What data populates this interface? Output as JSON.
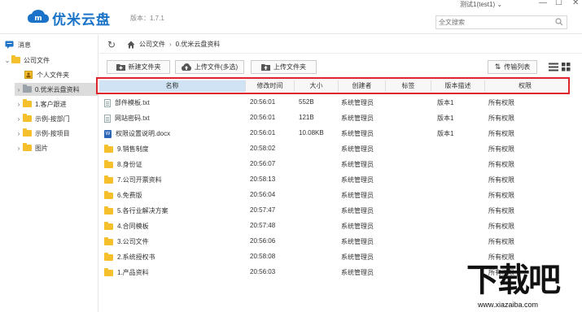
{
  "app": {
    "brand": "优米云盘",
    "version": "版本：1.7.1",
    "user": "测试1(test1)",
    "search_placeholder": "全文搜索"
  },
  "sidebar": {
    "items": [
      {
        "label": "消息"
      },
      {
        "label": "公司文件"
      },
      {
        "label": "个人文件夹"
      },
      {
        "label": "0.优米云盘资料"
      },
      {
        "label": "1.客户跟进"
      },
      {
        "label": "示例-按部门"
      },
      {
        "label": "示例-按项目"
      },
      {
        "label": "图片"
      }
    ]
  },
  "breadcrumb": {
    "items": [
      "公司文件",
      "0.优米云盘资料"
    ]
  },
  "toolbar": {
    "new_folder": "新建文件夹",
    "upload_file": "上传文件(多选)",
    "upload_folder": "上传文件夹",
    "transfer_list": "传输列表"
  },
  "table": {
    "columns": [
      "名称",
      "修改时间",
      "大小",
      "创建者",
      "标签",
      "版本描述",
      "权限"
    ],
    "rows": [
      {
        "name": "部件模板.txt",
        "type": "txt",
        "time": "20:56:01",
        "size": "552B",
        "creator": "系统管理员",
        "tag": "",
        "version": "版本1",
        "perm": "所有权限"
      },
      {
        "name": "网站密码.txt",
        "type": "txt",
        "time": "20:56:01",
        "size": "121B",
        "creator": "系统管理员",
        "tag": "",
        "version": "版本1",
        "perm": "所有权限"
      },
      {
        "name": "权限设置说明.docx",
        "type": "docx",
        "time": "20:56:01",
        "size": "10.08KB",
        "creator": "系统管理员",
        "tag": "",
        "version": "版本1",
        "perm": "所有权限"
      },
      {
        "name": "9.销售制度",
        "type": "folder",
        "time": "20:58:02",
        "size": "",
        "creator": "系统管理员",
        "tag": "",
        "version": "",
        "perm": "所有权限"
      },
      {
        "name": "8.身份证",
        "type": "folder",
        "time": "20:56:07",
        "size": "",
        "creator": "系统管理员",
        "tag": "",
        "version": "",
        "perm": "所有权限"
      },
      {
        "name": "7.公司开票资料",
        "type": "folder",
        "time": "20:58:13",
        "size": "",
        "creator": "系统管理员",
        "tag": "",
        "version": "",
        "perm": "所有权限"
      },
      {
        "name": "6.免费版",
        "type": "folder",
        "time": "20:56:04",
        "size": "",
        "creator": "系统管理员",
        "tag": "",
        "version": "",
        "perm": "所有权限"
      },
      {
        "name": "5.各行业解决方案",
        "type": "folder",
        "time": "20:57:47",
        "size": "",
        "creator": "系统管理员",
        "tag": "",
        "version": "",
        "perm": "所有权限"
      },
      {
        "name": "4.合同模板",
        "type": "folder",
        "time": "20:57:48",
        "size": "",
        "creator": "系统管理员",
        "tag": "",
        "version": "",
        "perm": "所有权限"
      },
      {
        "name": "3.公司文件",
        "type": "folder",
        "time": "20:56:06",
        "size": "",
        "creator": "系统管理员",
        "tag": "",
        "version": "",
        "perm": "所有权限"
      },
      {
        "name": "2.系统授权书",
        "type": "folder",
        "time": "20:58:08",
        "size": "",
        "creator": "系统管理员",
        "tag": "",
        "version": "",
        "perm": "所有权限"
      },
      {
        "name": "1.产品资料",
        "type": "folder",
        "time": "20:56:03",
        "size": "",
        "creator": "系统管理员",
        "tag": "",
        "version": "",
        "perm": "所有权限"
      }
    ]
  },
  "watermark": {
    "big": "下载吧",
    "small": "www.xiazaiba.com"
  },
  "colors": {
    "brand": "#1a73c8",
    "highlight_border": "#e0242b",
    "folder": "#f5c02c",
    "sorted_header": "#cfe3f5"
  }
}
